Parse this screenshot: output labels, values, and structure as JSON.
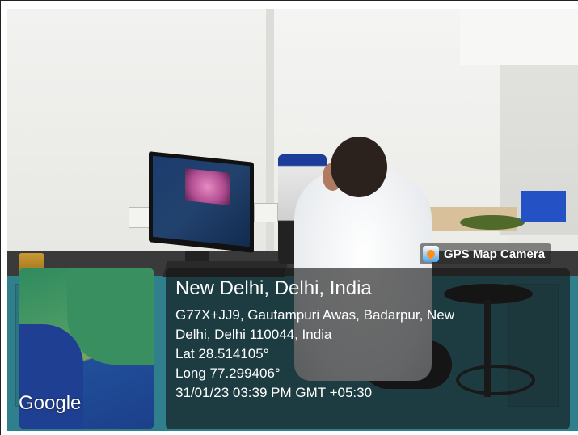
{
  "app_badge": {
    "name": "GPS Map Camera",
    "icon": "gps-map-camera-icon"
  },
  "map": {
    "provider_logo": "Google"
  },
  "location": {
    "title": "New Delhi, Delhi, India",
    "address_line1": "G77X+JJ9, Gautampuri Awas, Badarpur, New",
    "address_line2": "Delhi, Delhi 110044, India",
    "latitude": "Lat 28.514105°",
    "longitude": "Long 77.299406°",
    "timestamp": "31/01/23 03:39 PM GMT +05:30"
  },
  "colors": {
    "panel_bg": "#141414",
    "cabinet": "#2f7f8c"
  }
}
